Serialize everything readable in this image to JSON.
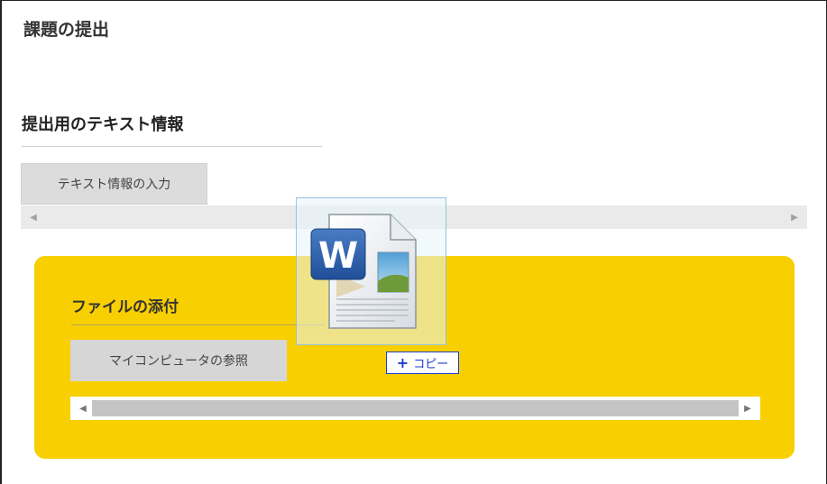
{
  "page": {
    "title": "課題の提出"
  },
  "text_section": {
    "title": "提出用のテキスト情報",
    "tab_label": "テキスト情報の入力"
  },
  "attach_section": {
    "title": "ファイルの添付",
    "browse_button": "マイコンピュータの参照"
  },
  "drag": {
    "icon": "word-document-icon",
    "copy_label": "コピー",
    "copy_symbol": "+"
  },
  "colors": {
    "panel": "#f8cf00",
    "copy_blue": "#1a3cc7",
    "word_blue": "#2b579a"
  }
}
